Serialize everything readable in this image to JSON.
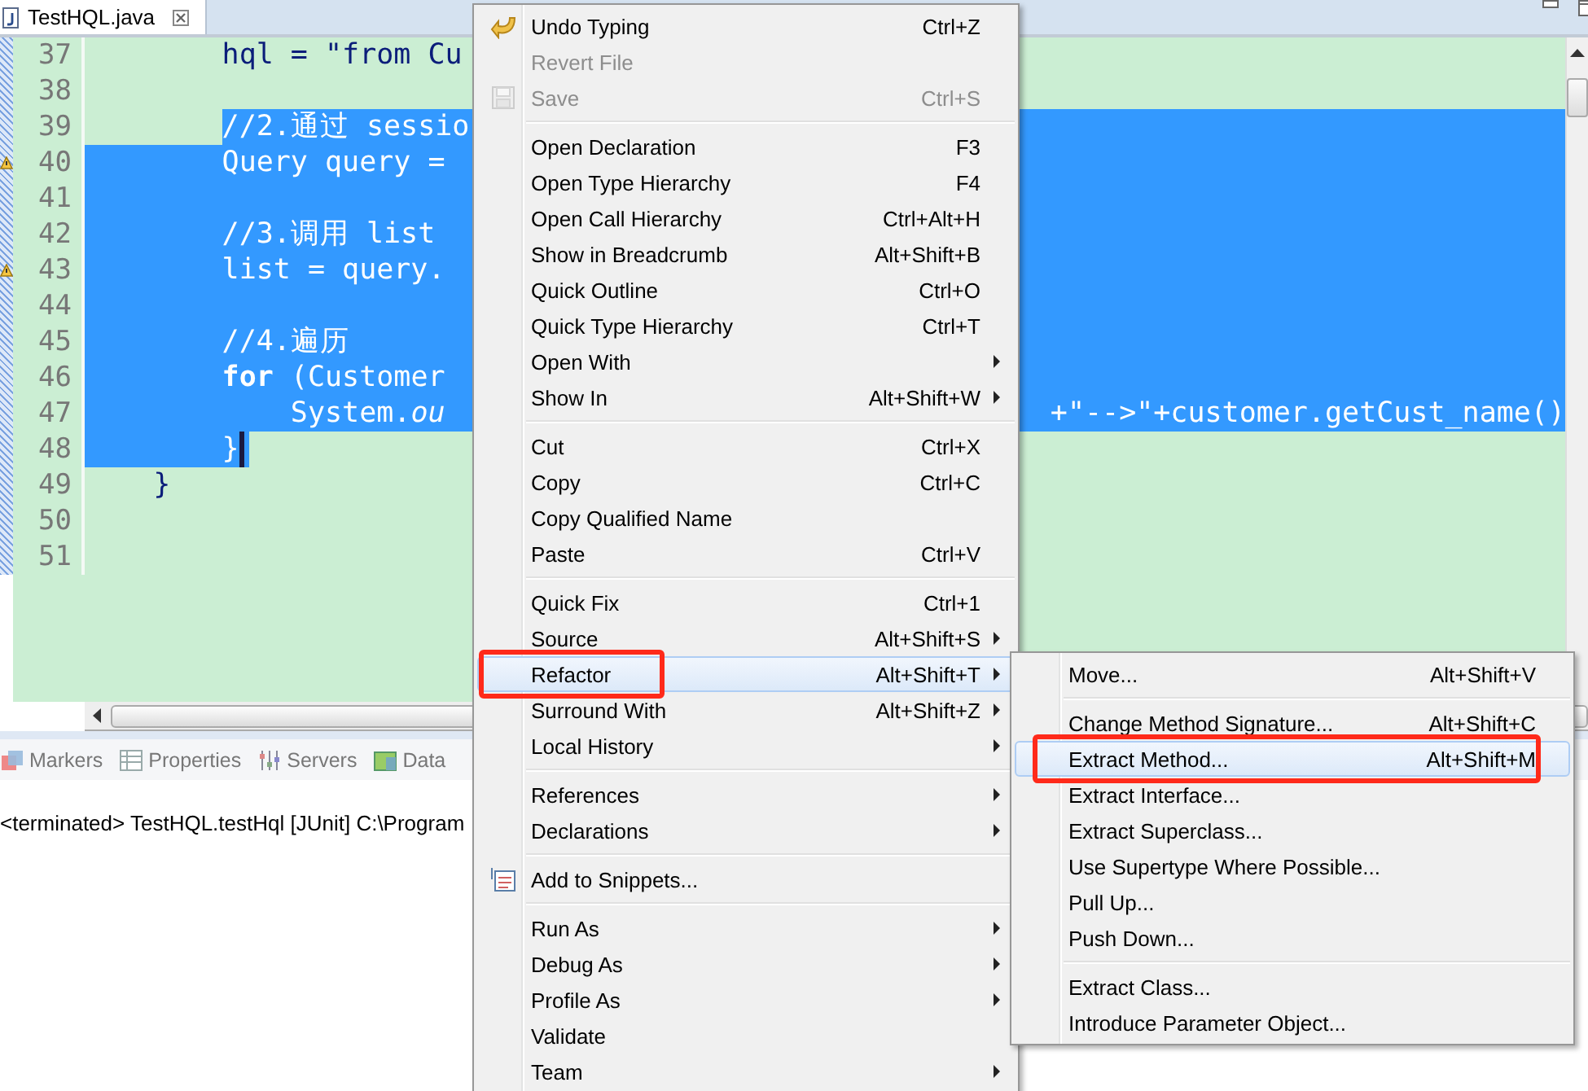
{
  "editor_tab": {
    "title": "TestHQL.java",
    "selected": true
  },
  "code_lines": [
    {
      "number": "37",
      "text": "        hql = \"from Cu",
      "kind": "unselected",
      "warning": false
    },
    {
      "number": "38",
      "kind": "unselected",
      "warning": false
    },
    {
      "number": "39",
      "text": "        //2.通过 sessio",
      "kind": "selection-start",
      "warning": false
    },
    {
      "number": "40",
      "text": "        Query query =",
      "kind": "selected",
      "warning": true
    },
    {
      "number": "41",
      "kind": "selected",
      "warning": false
    },
    {
      "number": "42",
      "text": "        //3.调用 list",
      "kind": "selected",
      "warning": false
    },
    {
      "number": "43",
      "text": "        list = query.",
      "kind": "selected",
      "warning": true
    },
    {
      "number": "44",
      "kind": "selected",
      "warning": false
    },
    {
      "number": "45",
      "text": "        //4.遍历",
      "kind": "selected",
      "warning": false
    },
    {
      "number": "46",
      "text": "        **for** (Customer",
      "kind": "selected",
      "warning": false
    },
    {
      "number": "47",
      "text": "            System.*ou*",
      "tail": "+\"-->\"+customer.getCust_name()",
      "kind": "selected",
      "warning": false
    },
    {
      "number": "48",
      "text": "        }",
      "kind": "selection-end",
      "caret": true,
      "warning": false
    },
    {
      "number": "49",
      "text": "    }",
      "kind": "unselected",
      "warning": false
    },
    {
      "number": "50",
      "kind": "unselected",
      "warning": false
    },
    {
      "number": "51",
      "kind": "unselected",
      "warning": false
    }
  ],
  "panel_tabs": [
    {
      "label": "Markers",
      "kind": "markers"
    },
    {
      "label": "Properties",
      "kind": "properties"
    },
    {
      "label": "Servers",
      "kind": "servers"
    },
    {
      "label": "Data",
      "kind": "data"
    }
  ],
  "console_text": "<terminated> TestHQL.testHql [JUnit] C:\\Program",
  "context_menu": [
    {
      "kind": "undo",
      "label": "Undo Typing",
      "shortcut": "Ctrl+Z",
      "disabled": false,
      "submenu": false,
      "selected": false
    },
    {
      "kind": "item",
      "label": "Revert File",
      "disabled": true,
      "submenu": false,
      "selected": false
    },
    {
      "kind": "save",
      "label": "Save",
      "shortcut": "Ctrl+S",
      "disabled": true,
      "submenu": false,
      "selected": false
    },
    {
      "kind": "separator"
    },
    {
      "kind": "item",
      "label": "Open Declaration",
      "shortcut": "F3",
      "disabled": false,
      "submenu": false,
      "selected": false
    },
    {
      "kind": "item",
      "label": "Open Type Hierarchy",
      "shortcut": "F4",
      "disabled": false,
      "submenu": false,
      "selected": false
    },
    {
      "kind": "item",
      "label": "Open Call Hierarchy",
      "shortcut": "Ctrl+Alt+H",
      "disabled": false,
      "submenu": false,
      "selected": false
    },
    {
      "kind": "item",
      "label": "Show in Breadcrumb",
      "shortcut": "Alt+Shift+B",
      "disabled": false,
      "submenu": false,
      "selected": false
    },
    {
      "kind": "item",
      "label": "Quick Outline",
      "shortcut": "Ctrl+O",
      "disabled": false,
      "submenu": false,
      "selected": false
    },
    {
      "kind": "item",
      "label": "Quick Type Hierarchy",
      "shortcut": "Ctrl+T",
      "disabled": false,
      "submenu": false,
      "selected": false
    },
    {
      "kind": "item",
      "label": "Open With",
      "disabled": false,
      "submenu": true,
      "selected": false
    },
    {
      "kind": "item",
      "label": "Show In",
      "shortcut": "Alt+Shift+W",
      "disabled": false,
      "submenu": true,
      "selected": false
    },
    {
      "kind": "separator"
    },
    {
      "kind": "item",
      "label": "Cut",
      "shortcut": "Ctrl+X",
      "disabled": false,
      "submenu": false,
      "selected": false
    },
    {
      "kind": "item",
      "label": "Copy",
      "shortcut": "Ctrl+C",
      "disabled": false,
      "submenu": false,
      "selected": false
    },
    {
      "kind": "item",
      "label": "Copy Qualified Name",
      "disabled": false,
      "submenu": false,
      "selected": false
    },
    {
      "kind": "item",
      "label": "Paste",
      "shortcut": "Ctrl+V",
      "disabled": false,
      "submenu": false,
      "selected": false
    },
    {
      "kind": "separator"
    },
    {
      "kind": "item",
      "label": "Quick Fix",
      "shortcut": "Ctrl+1",
      "disabled": false,
      "submenu": false,
      "selected": false
    },
    {
      "kind": "item",
      "label": "Source",
      "shortcut": "Alt+Shift+S",
      "disabled": false,
      "submenu": true,
      "selected": false
    },
    {
      "kind": "item",
      "label": "Refactor",
      "shortcut": "Alt+Shift+T",
      "disabled": false,
      "submenu": true,
      "selected": true,
      "annotated": true
    },
    {
      "kind": "item",
      "label": "Surround With",
      "shortcut": "Alt+Shift+Z",
      "disabled": false,
      "submenu": true,
      "selected": false
    },
    {
      "kind": "item",
      "label": "Local History",
      "disabled": false,
      "submenu": true,
      "selected": false
    },
    {
      "kind": "separator"
    },
    {
      "kind": "item",
      "label": "References",
      "disabled": false,
      "submenu": true,
      "selected": false
    },
    {
      "kind": "item",
      "label": "Declarations",
      "disabled": false,
      "submenu": true,
      "selected": false
    },
    {
      "kind": "separator"
    },
    {
      "kind": "snippets",
      "label": "Add to Snippets...",
      "disabled": false,
      "submenu": false,
      "selected": false
    },
    {
      "kind": "separator"
    },
    {
      "kind": "item",
      "label": "Run As",
      "disabled": false,
      "submenu": true,
      "selected": false
    },
    {
      "kind": "item",
      "label": "Debug As",
      "disabled": false,
      "submenu": true,
      "selected": false
    },
    {
      "kind": "item",
      "label": "Profile As",
      "disabled": false,
      "submenu": true,
      "selected": false
    },
    {
      "kind": "item",
      "label": "Validate",
      "disabled": false,
      "submenu": false,
      "selected": false
    },
    {
      "kind": "item",
      "label": "Team",
      "disabled": false,
      "submenu": true,
      "selected": false
    }
  ],
  "refactor_submenu": [
    {
      "kind": "item",
      "label": "Move...",
      "shortcut": "Alt+Shift+V",
      "selected": false
    },
    {
      "kind": "separator"
    },
    {
      "kind": "item",
      "label": "Change Method Signature...",
      "shortcut": "Alt+Shift+C",
      "selected": false
    },
    {
      "kind": "item",
      "label": "Extract Method...",
      "shortcut": "Alt+Shift+M",
      "selected": true,
      "annotated": true
    },
    {
      "kind": "item",
      "label": "Extract Interface...",
      "selected": false
    },
    {
      "kind": "item",
      "label": "Extract Superclass...",
      "selected": false
    },
    {
      "kind": "item",
      "label": "Use Supertype Where Possible...",
      "selected": false
    },
    {
      "kind": "item",
      "label": "Pull Up...",
      "selected": false
    },
    {
      "kind": "item",
      "label": "Push Down...",
      "selected": false
    },
    {
      "kind": "separator"
    },
    {
      "kind": "item",
      "label": "Extract Class...",
      "selected": false
    },
    {
      "kind": "item",
      "label": "Introduce Parameter Object...",
      "selected": false
    }
  ]
}
